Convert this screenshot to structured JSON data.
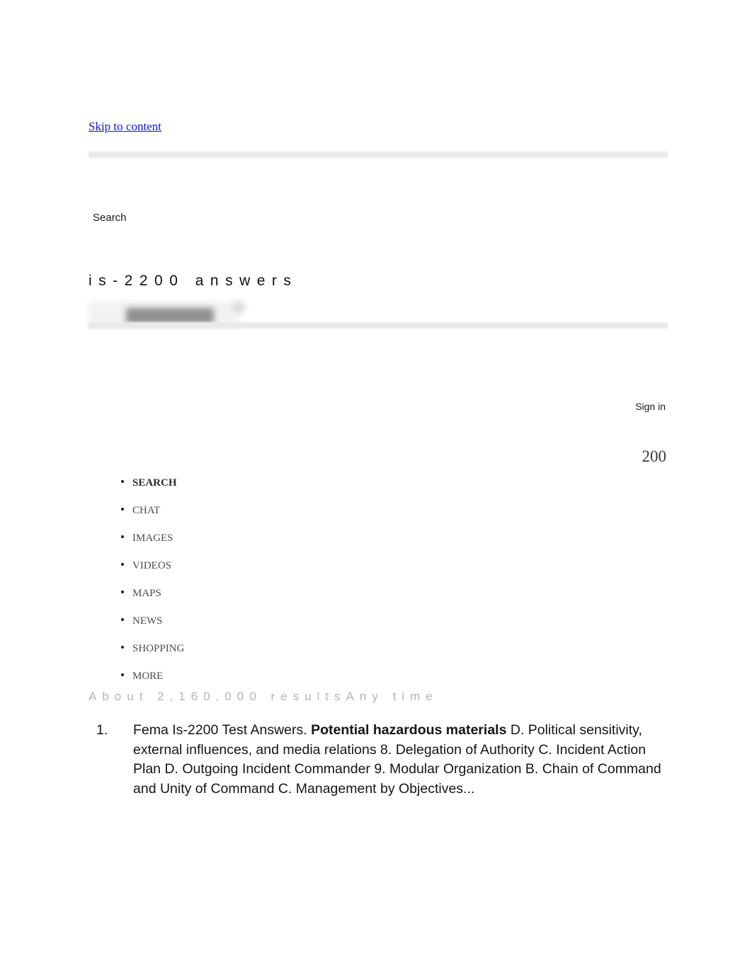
{
  "accessibility": {
    "skip_link_label": "Skip to content",
    "link_color": "#1414cc"
  },
  "search_bar": {
    "submit_label": "Search",
    "query_heading": "is-2200 answers",
    "redacted": true
  },
  "account": {
    "sign_in_label": "Sign in"
  },
  "badge": {
    "value": "200"
  },
  "nav": {
    "items": [
      {
        "label": "SEARCH",
        "active": true
      },
      {
        "label": "CHAT",
        "active": false
      },
      {
        "label": "IMAGES",
        "active": false
      },
      {
        "label": "VIDEOS",
        "active": false
      },
      {
        "label": "MAPS",
        "active": false
      },
      {
        "label": "NEWS",
        "active": false
      },
      {
        "label": "SHOPPING",
        "active": false
      },
      {
        "label": "MORE",
        "active": false
      }
    ]
  },
  "results_meta": {
    "text": "About 2,160,000 resultsAny time",
    "count_label": "About 2,160,000 results",
    "time_filter": "Any time"
  },
  "results": {
    "items": [
      {
        "marker": "1.",
        "text_before": "Fema Is-2200 Test Answers. ",
        "highlight": "Potential hazardous materials",
        "text_after": " D. Political sensitivity, external influences, and media relations 8. Delegation of Authority C. Incident Action Plan D. Outgoing Incident Commander 9. Modular Organization B. Chain of Command and Unity of Command C. Management by Objectives..."
      }
    ]
  }
}
